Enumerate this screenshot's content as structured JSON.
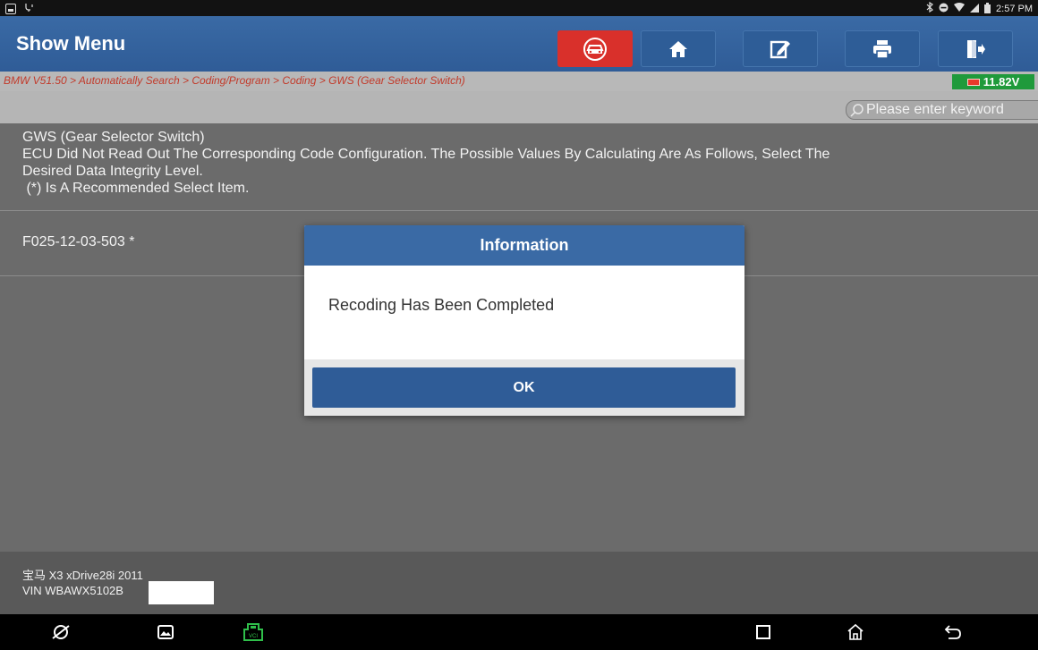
{
  "status_bar": {
    "time": "2:57 PM"
  },
  "header": {
    "title": "Show Menu",
    "toolbar": [
      {
        "name": "diagnosis",
        "icon": "car-diagnosis-icon",
        "active": true
      },
      {
        "name": "home",
        "icon": "home-icon",
        "active": false
      },
      {
        "name": "report",
        "icon": "edit-report-icon",
        "active": false
      },
      {
        "name": "print",
        "icon": "printer-icon",
        "active": false
      },
      {
        "name": "exit",
        "icon": "exit-icon",
        "active": false
      }
    ]
  },
  "breadcrumb": "BMW V51.50 > Automatically Search > Coding/Program > Coding > GWS (Gear Selector Switch)",
  "voltage": "11.82V",
  "search": {
    "placeholder": "Please enter keyword"
  },
  "info": {
    "line1": "GWS (Gear Selector Switch)",
    "line2": "ECU Did Not Read Out The Corresponding Code Configuration. The Possible Values By Calculating Are As Follows, Select The",
    "line3": "Desired Data Integrity Level.",
    "line4": " (*) Is A Recommended Select Item."
  },
  "options": [
    {
      "label": "F025-12-03-503 *"
    }
  ],
  "vehicle": {
    "model": "宝马 X3 xDrive28i 2011",
    "vin": "VIN WBAWX5102B"
  },
  "dialog": {
    "title": "Information",
    "message": "Recoding Has Been Completed",
    "ok_label": "OK"
  },
  "colors": {
    "header_blue": "#3a6aa5",
    "active_red": "#d9302b",
    "breadcrumb_red": "#c23a2a",
    "voltage_green": "#1f9a3b",
    "vci_green": "#2fbf4a"
  }
}
